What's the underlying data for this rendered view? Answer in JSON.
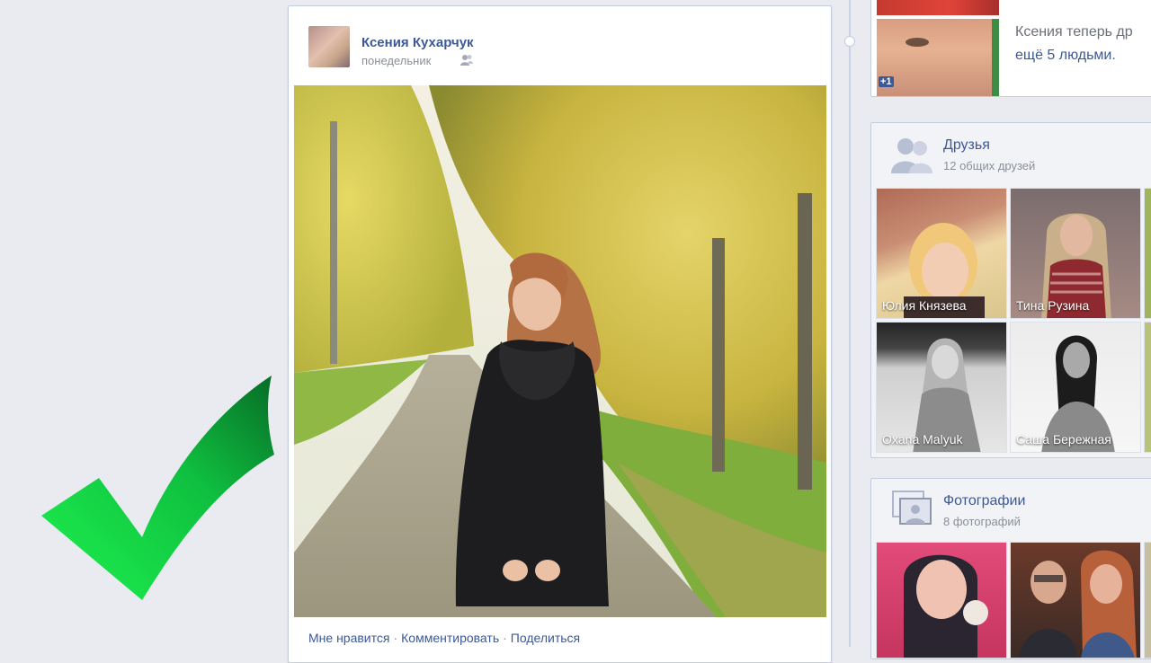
{
  "post": {
    "author": "Ксения Кухарчук",
    "time": "понедельник",
    "actions": {
      "like": "Мне нравится",
      "comment": "Комментировать",
      "share": "Поделиться"
    }
  },
  "activity": {
    "line1": "Ксения теперь др",
    "line2": "ещё 5 людьми.",
    "badge": "+1"
  },
  "friends_card": {
    "title": "Друзья",
    "subtitle": "12 общих друзей",
    "friends": [
      {
        "name": "Юлия Князева"
      },
      {
        "name": "Тина Рузина"
      },
      {
        "name": "Oxana Malyuk"
      },
      {
        "name": "Саша Бережная"
      }
    ]
  },
  "photos_card": {
    "title": "Фотографии",
    "subtitle": "8 фотографий"
  },
  "colors": {
    "link": "#3b5998",
    "check_green_light": "#19e04a",
    "check_green_dark": "#0a7a2c"
  }
}
